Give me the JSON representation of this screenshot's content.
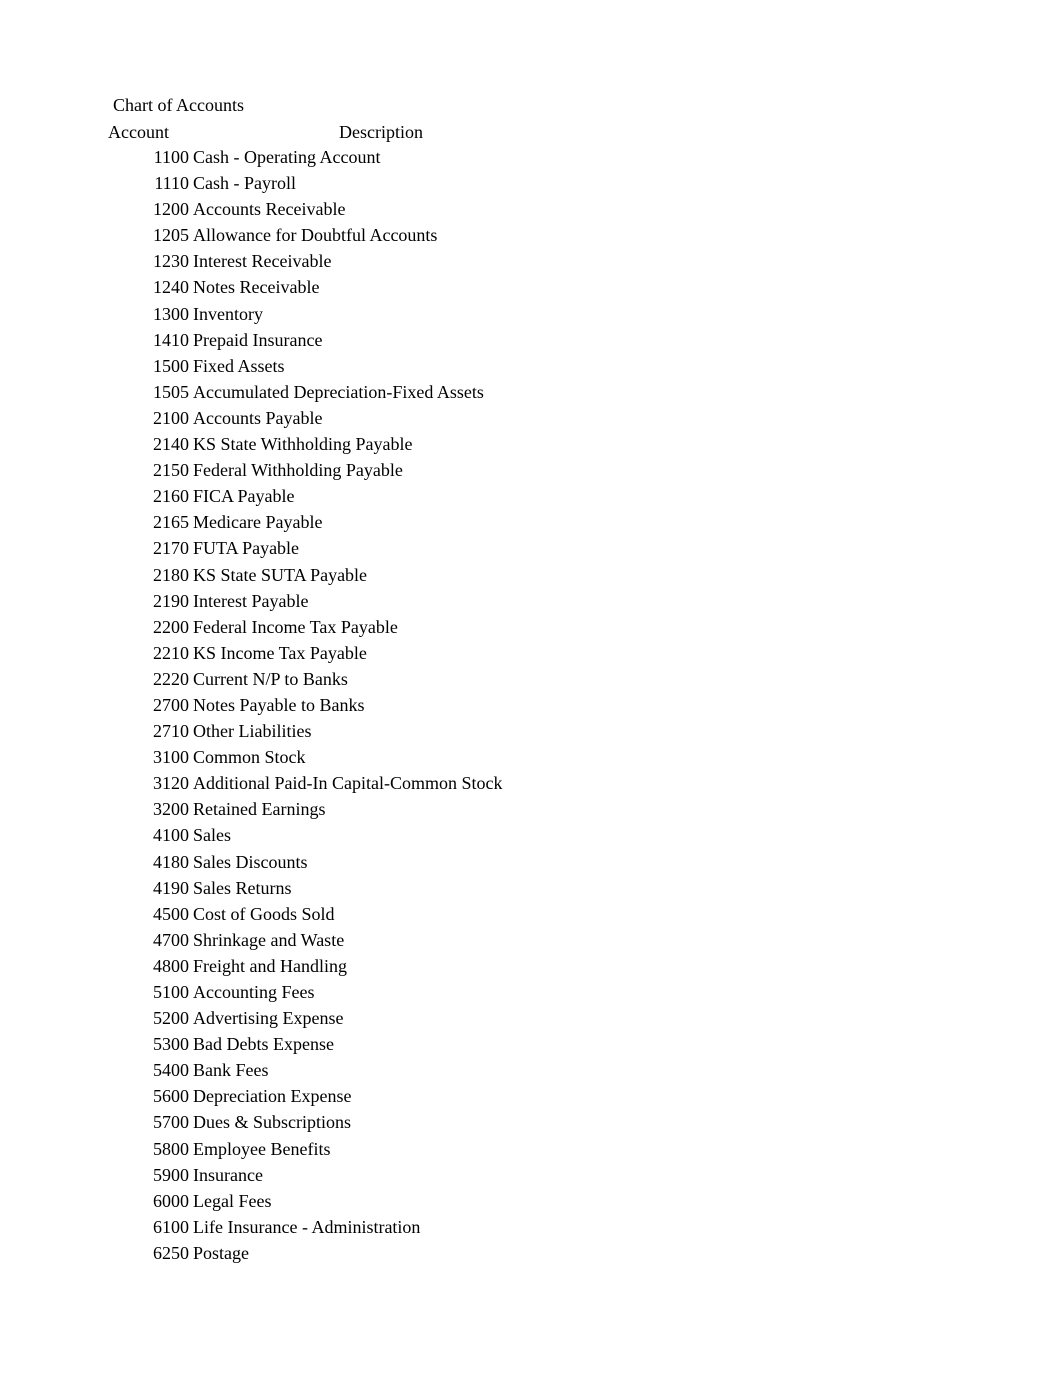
{
  "document": {
    "title": "Chart of Accounts",
    "columns": {
      "account": "Account",
      "description": "Description"
    },
    "accounts": [
      {
        "number": "1100",
        "description": "Cash - Operating Account"
      },
      {
        "number": "1110",
        "description": "Cash - Payroll"
      },
      {
        "number": "1200",
        "description": "Accounts Receivable"
      },
      {
        "number": "1205",
        "description": "Allowance for Doubtful Accounts"
      },
      {
        "number": "1230",
        "description": "Interest Receivable"
      },
      {
        "number": "1240",
        "description": "Notes Receivable"
      },
      {
        "number": "1300",
        "description": "Inventory"
      },
      {
        "number": "1410",
        "description": "Prepaid Insurance"
      },
      {
        "number": "1500",
        "description": "Fixed Assets"
      },
      {
        "number": "1505",
        "description": "Accumulated Depreciation-Fixed Assets"
      },
      {
        "number": "2100",
        "description": "Accounts Payable"
      },
      {
        "number": "2140",
        "description": "KS State Withholding Payable"
      },
      {
        "number": "2150",
        "description": "Federal Withholding Payable"
      },
      {
        "number": "2160",
        "description": "FICA Payable"
      },
      {
        "number": "2165",
        "description": "Medicare Payable"
      },
      {
        "number": "2170",
        "description": "FUTA Payable"
      },
      {
        "number": "2180",
        "description": "KS State SUTA Payable"
      },
      {
        "number": "2190",
        "description": "Interest Payable"
      },
      {
        "number": "2200",
        "description": "Federal Income Tax Payable"
      },
      {
        "number": "2210",
        "description": "KS Income Tax Payable"
      },
      {
        "number": "2220",
        "description": "Current N/P to Banks"
      },
      {
        "number": "2700",
        "description": "Notes Payable to Banks"
      },
      {
        "number": "2710",
        "description": "Other Liabilities"
      },
      {
        "number": "3100",
        "description": "Common Stock"
      },
      {
        "number": "3120",
        "description": "Additional Paid-In Capital-Common Stock"
      },
      {
        "number": "3200",
        "description": "Retained Earnings"
      },
      {
        "number": "4100",
        "description": "Sales"
      },
      {
        "number": "4180",
        "description": "Sales Discounts"
      },
      {
        "number": "4190",
        "description": "Sales Returns"
      },
      {
        "number": "4500",
        "description": "Cost of Goods Sold"
      },
      {
        "number": "4700",
        "description": "Shrinkage and Waste"
      },
      {
        "number": "4800",
        "description": "Freight and Handling"
      },
      {
        "number": "5100",
        "description": "Accounting Fees"
      },
      {
        "number": "5200",
        "description": "Advertising Expense"
      },
      {
        "number": "5300",
        "description": "Bad Debts Expense"
      },
      {
        "number": "5400",
        "description": "Bank Fees"
      },
      {
        "number": "5600",
        "description": "Depreciation Expense"
      },
      {
        "number": "5700",
        "description": "Dues & Subscriptions"
      },
      {
        "number": "5800",
        "description": "Employee Benefits"
      },
      {
        "number": "5900",
        "description": "Insurance"
      },
      {
        "number": "6000",
        "description": "Legal Fees"
      },
      {
        "number": "6100",
        "description": "Life Insurance - Administration"
      },
      {
        "number": "6250",
        "description": "Postage"
      }
    ]
  }
}
